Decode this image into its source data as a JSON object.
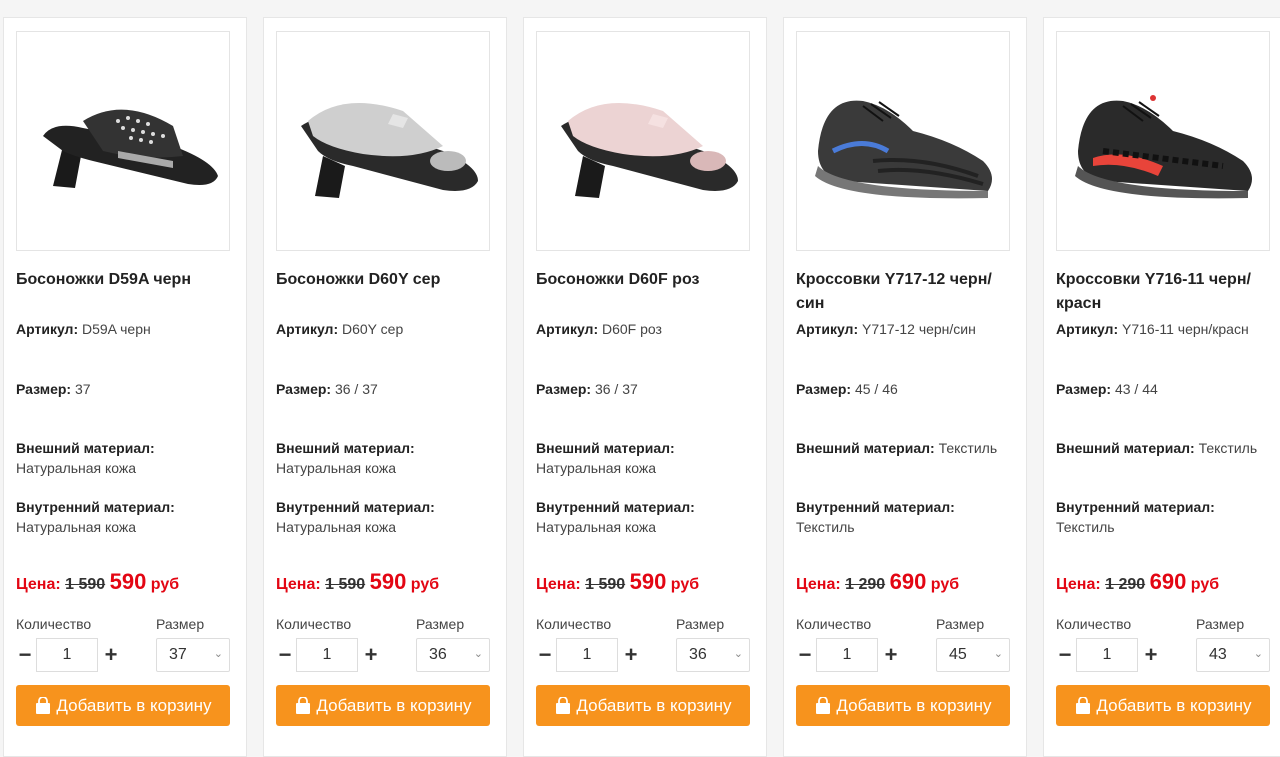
{
  "labels": {
    "article": "Артикул:",
    "size": "Размер:",
    "outer": "Внешний материал:",
    "inner": "Внутренний материал:",
    "price": "Цена:",
    "currency": "руб",
    "qty": "Количество",
    "size_select": "Размер",
    "add": "Добавить в корзину",
    "minus": "−",
    "plus": "+",
    "chevron": "⌄"
  },
  "colors": {
    "accent": "#f7931d",
    "price": "#e30613"
  },
  "products": [
    {
      "title": "Босоножки D59A черн",
      "article": "D59A черн",
      "size": "37",
      "outer": "Натуральная кожа",
      "inner": "Натуральная кожа",
      "old_price": "1 590",
      "price": "590",
      "qty": "1",
      "size_selected": "37",
      "image_icon": "black-sandal-image"
    },
    {
      "title": "Босоножки D60Y сер",
      "article": "D60Y сер",
      "size": "36 / 37",
      "outer": "Натуральная кожа",
      "inner": "Натуральная кожа",
      "old_price": "1 590",
      "price": "590",
      "qty": "1",
      "size_selected": "36",
      "image_icon": "silver-sandal-image"
    },
    {
      "title": "Босоножки D60F роз",
      "article": "D60F роз",
      "size": "36 / 37",
      "outer": "Натуральная кожа",
      "inner": "Натуральная кожа",
      "old_price": "1 590",
      "price": "590",
      "qty": "1",
      "size_selected": "36",
      "image_icon": "pink-sandal-image"
    },
    {
      "title": "Кроссовки Y717-12 черн/син",
      "article": "Y717-12 черн/син",
      "size": "45 / 46",
      "outer": "Текстиль",
      "inner": "Текстиль",
      "old_price": "1 290",
      "price": "690",
      "qty": "1",
      "size_selected": "45",
      "image_icon": "black-blue-sneaker-image"
    },
    {
      "title": "Кроссовки Y716-11 черн/красн",
      "article": "Y716-11 черн/красн",
      "size": "43 / 44",
      "outer": "Текстиль",
      "inner": "Текстиль",
      "old_price": "1 290",
      "price": "690",
      "qty": "1",
      "size_selected": "43",
      "image_icon": "black-red-sneaker-image"
    }
  ]
}
